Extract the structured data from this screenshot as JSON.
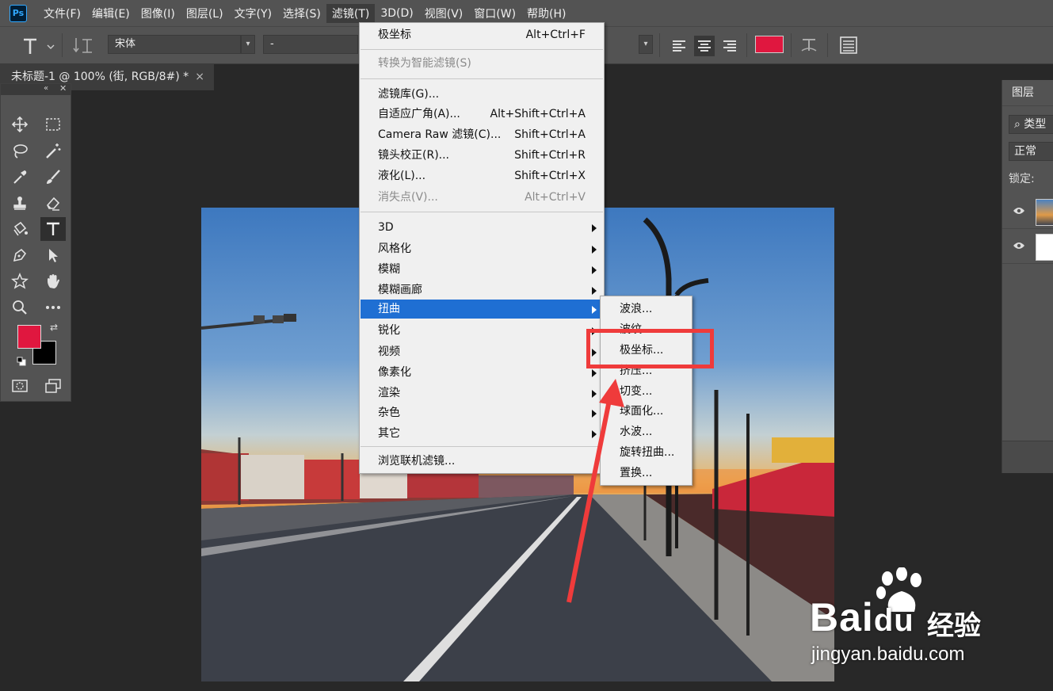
{
  "app": {
    "logo_text": "Ps"
  },
  "menubar": {
    "items": [
      "文件(F)",
      "编辑(E)",
      "图像(I)",
      "图层(L)",
      "文字(Y)",
      "选择(S)",
      "滤镜(T)",
      "3D(D)",
      "视图(V)",
      "窗口(W)",
      "帮助(H)"
    ],
    "active_index": 6
  },
  "options": {
    "font_family": "宋体",
    "font_style": "-",
    "text_color": "#e0173f"
  },
  "document": {
    "tab_title": "未标题-1 @ 100% (街, RGB/8#) *",
    "close_glyph": "×"
  },
  "tools": {
    "foreground_color": "#e0173f",
    "background_color": "#000000"
  },
  "layers_panel": {
    "tab": "图层",
    "filter_label": "类型",
    "blend_mode": "正常",
    "lock_label": "锁定:"
  },
  "filter_menu": {
    "items": [
      {
        "label": "极坐标",
        "shortcut": "Alt+Ctrl+F",
        "disabled": false
      },
      {
        "label": "转换为智能滤镜(S)",
        "shortcut": "",
        "disabled": true
      },
      {
        "label": "滤镜库(G)...",
        "shortcut": "",
        "disabled": false
      },
      {
        "label": "自适应广角(A)...",
        "shortcut": "Alt+Shift+Ctrl+A",
        "disabled": false
      },
      {
        "label": "Camera Raw 滤镜(C)...",
        "shortcut": "Shift+Ctrl+A",
        "disabled": false
      },
      {
        "label": "镜头校正(R)...",
        "shortcut": "Shift+Ctrl+R",
        "disabled": false
      },
      {
        "label": "液化(L)...",
        "shortcut": "Shift+Ctrl+X",
        "disabled": false
      },
      {
        "label": "消失点(V)...",
        "shortcut": "Alt+Ctrl+V",
        "disabled": true
      },
      {
        "label": "3D",
        "submenu": true
      },
      {
        "label": "风格化",
        "submenu": true
      },
      {
        "label": "模糊",
        "submenu": true
      },
      {
        "label": "模糊画廊",
        "submenu": true
      },
      {
        "label": "扭曲",
        "submenu": true,
        "highlighted": true
      },
      {
        "label": "锐化",
        "submenu": true
      },
      {
        "label": "视频",
        "submenu": true
      },
      {
        "label": "像素化",
        "submenu": true
      },
      {
        "label": "渲染",
        "submenu": true
      },
      {
        "label": "杂色",
        "submenu": true
      },
      {
        "label": "其它",
        "submenu": true
      },
      {
        "label": "浏览联机滤镜...",
        "shortcut": "",
        "disabled": false
      }
    ]
  },
  "distort_submenu": {
    "items": [
      "波浪...",
      "波纹...",
      "极坐标...",
      "挤压...",
      "切变...",
      "球面化...",
      "水波...",
      "旋转扭曲...",
      "置换..."
    ]
  },
  "annotation": {
    "highlight_color": "#ef3b3b"
  },
  "watermark": {
    "brand": "Bai",
    "brand_suffix": "du",
    "cn": "经验",
    "url": "jingyan.baidu.com"
  }
}
